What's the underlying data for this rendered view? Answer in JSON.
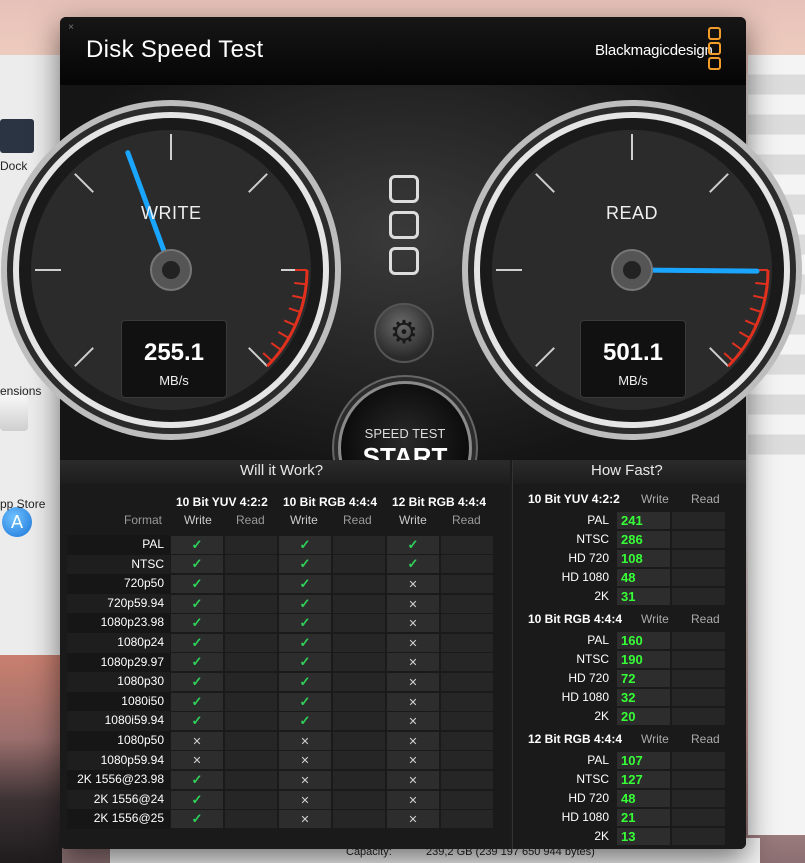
{
  "background": {
    "left_labels": [
      "Dock",
      "ensions",
      "pp Store"
    ],
    "capacity_label": "Capacity:",
    "capacity_value": "239,2 GB (239 197 650 944 bytes)"
  },
  "window": {
    "title": "Disk Speed Test",
    "brand": "Blackmagicdesign"
  },
  "gauges": {
    "write": {
      "label": "WRITE",
      "value": "255.1",
      "unit": "MB/s",
      "needle_value": 255.1,
      "max": 600
    },
    "read": {
      "label": "READ",
      "value": "501.1",
      "unit": "MB/s",
      "needle_value": 501.1,
      "max": 600
    }
  },
  "controls": {
    "start_small": "SPEED TEST",
    "start_big": "START"
  },
  "will_it_work": {
    "title": "Will it Work?",
    "format_header": "Format",
    "groups": [
      "10 Bit YUV 4:2:2",
      "10 Bit RGB 4:4:4",
      "12 Bit RGB 4:4:4"
    ],
    "write_label": "Write",
    "read_label": "Read",
    "rows": [
      {
        "format": "PAL",
        "r": [
          "ok",
          "ok",
          "ok"
        ]
      },
      {
        "format": "NTSC",
        "r": [
          "ok",
          "ok",
          "ok"
        ]
      },
      {
        "format": "720p50",
        "r": [
          "ok",
          "ok",
          "no"
        ]
      },
      {
        "format": "720p59.94",
        "r": [
          "ok",
          "ok",
          "no"
        ]
      },
      {
        "format": "1080p23.98",
        "r": [
          "ok",
          "ok",
          "no"
        ]
      },
      {
        "format": "1080p24",
        "r": [
          "ok",
          "ok",
          "no"
        ]
      },
      {
        "format": "1080p29.97",
        "r": [
          "ok",
          "ok",
          "no"
        ]
      },
      {
        "format": "1080p30",
        "r": [
          "ok",
          "ok",
          "no"
        ]
      },
      {
        "format": "1080i50",
        "r": [
          "ok",
          "ok",
          "no"
        ]
      },
      {
        "format": "1080i59.94",
        "r": [
          "ok",
          "ok",
          "no"
        ]
      },
      {
        "format": "1080p50",
        "r": [
          "no",
          "no",
          "no"
        ]
      },
      {
        "format": "1080p59.94",
        "r": [
          "no",
          "no",
          "no"
        ]
      },
      {
        "format": "2K 1556@23.98",
        "r": [
          "ok",
          "no",
          "no"
        ]
      },
      {
        "format": "2K 1556@24",
        "r": [
          "ok",
          "no",
          "no"
        ]
      },
      {
        "format": "2K 1556@25",
        "r": [
          "ok",
          "no",
          "no"
        ]
      }
    ],
    "ok_glyph": "✓",
    "no_glyph": "✕"
  },
  "how_fast": {
    "title": "How Fast?",
    "write_label": "Write",
    "read_label": "Read",
    "blocks": [
      {
        "name": "10 Bit YUV 4:2:2",
        "rows": [
          [
            "PAL",
            "241"
          ],
          [
            "NTSC",
            "286"
          ],
          [
            "HD 720",
            "108"
          ],
          [
            "HD 1080",
            "48"
          ],
          [
            "2K",
            "31"
          ]
        ]
      },
      {
        "name": "10 Bit RGB 4:4:4",
        "rows": [
          [
            "PAL",
            "160"
          ],
          [
            "NTSC",
            "190"
          ],
          [
            "HD 720",
            "72"
          ],
          [
            "HD 1080",
            "32"
          ],
          [
            "2K",
            "20"
          ]
        ]
      },
      {
        "name": "12 Bit RGB 4:4:4",
        "rows": [
          [
            "PAL",
            "107"
          ],
          [
            "NTSC",
            "127"
          ],
          [
            "HD 720",
            "48"
          ],
          [
            "HD 1080",
            "21"
          ],
          [
            "2K",
            "13"
          ]
        ]
      }
    ]
  }
}
